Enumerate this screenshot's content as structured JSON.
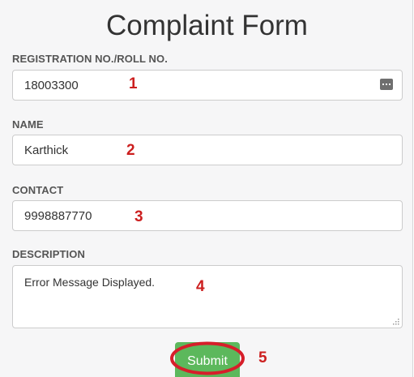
{
  "form": {
    "title": "Complaint Form",
    "fields": [
      {
        "label": "REGISTRATION NO./ROLL NO.",
        "value": "18003300",
        "marker": "1"
      },
      {
        "label": "NAME",
        "value": "Karthick",
        "marker": "2"
      },
      {
        "label": "CONTACT",
        "value": "9998887770",
        "marker": "3"
      },
      {
        "label": "DESCRIPTION",
        "value": "Error Message Displayed.",
        "marker": "4"
      }
    ],
    "submit": {
      "label": "Submit",
      "marker": "5"
    }
  },
  "colors": {
    "submit_bg": "#5cb85c",
    "marker": "#cc1f1f",
    "ring": "#d61e2a"
  },
  "icons": {
    "registration_field": "keyboard-icon",
    "description_field": "resize-grip-icon"
  }
}
